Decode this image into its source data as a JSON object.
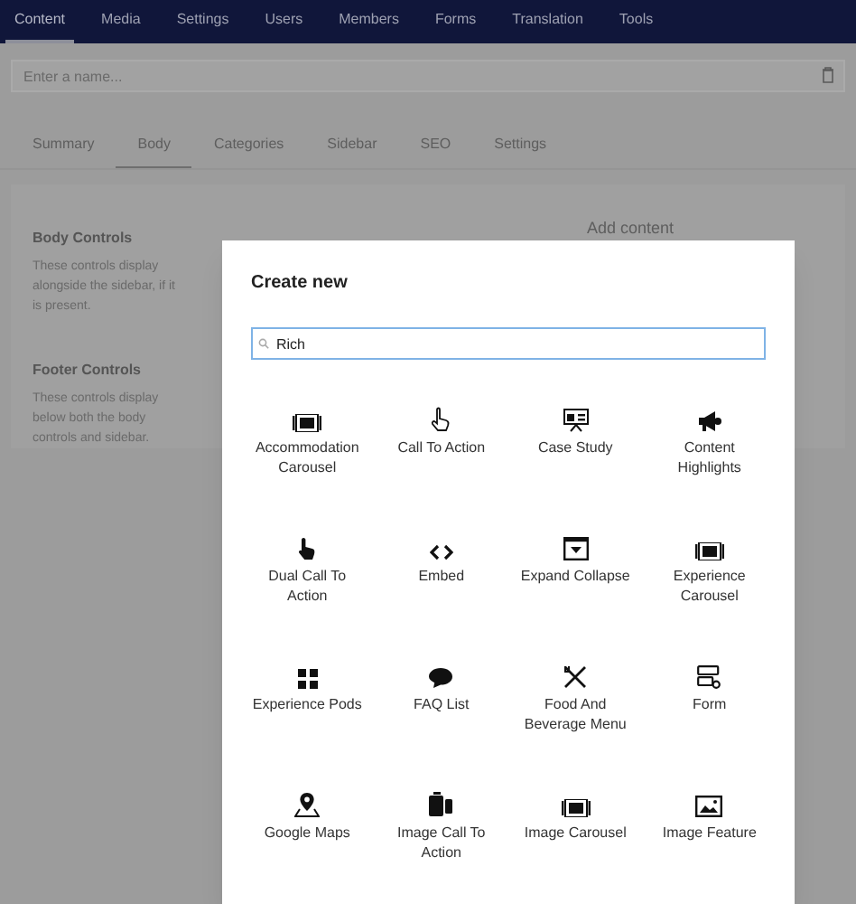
{
  "nav": [
    {
      "label": "Content",
      "selected": true
    },
    {
      "label": "Media",
      "selected": false
    },
    {
      "label": "Settings",
      "selected": false
    },
    {
      "label": "Users",
      "selected": false
    },
    {
      "label": "Members",
      "selected": false
    },
    {
      "label": "Forms",
      "selected": false
    },
    {
      "label": "Translation",
      "selected": false
    },
    {
      "label": "Tools",
      "selected": false
    }
  ],
  "name_field": {
    "placeholder": "Enter a name..."
  },
  "tabs": [
    {
      "label": "Summary",
      "selected": false
    },
    {
      "label": "Body",
      "selected": true
    },
    {
      "label": "Categories",
      "selected": false
    },
    {
      "label": "Sidebar",
      "selected": false
    },
    {
      "label": "SEO",
      "selected": false
    },
    {
      "label": "Settings",
      "selected": false
    }
  ],
  "sections": [
    {
      "title": "Body Controls",
      "description": "These controls display alongside the sidebar, if it is present."
    },
    {
      "title": "Footer Controls",
      "description": "These controls display below both the body controls and sidebar."
    }
  ],
  "add_content": "Add content",
  "dialog": {
    "title": "Create new",
    "search": {
      "value": "Rich"
    },
    "items": [
      {
        "label": "Accommodation Carousel",
        "kind": "carousel"
      },
      {
        "label": "Call To Action",
        "kind": "pointer"
      },
      {
        "label": "Case Study",
        "kind": "presentation"
      },
      {
        "label": "Content Highlights",
        "kind": "megaphone"
      },
      {
        "label": "Dual Call To Action",
        "kind": "hand"
      },
      {
        "label": "Embed",
        "kind": "code"
      },
      {
        "label": "Expand Collapse",
        "kind": "expand"
      },
      {
        "label": "Experience Carousel",
        "kind": "carousel"
      },
      {
        "label": "Experience Pods",
        "kind": "grid"
      },
      {
        "label": "FAQ List",
        "kind": "chat"
      },
      {
        "label": "Food And Beverage Menu",
        "kind": "cutlery"
      },
      {
        "label": "Form",
        "kind": "form"
      },
      {
        "label": "Google Maps",
        "kind": "map"
      },
      {
        "label": "Image Call To Action",
        "kind": "devices"
      },
      {
        "label": "Image Carousel",
        "kind": "carousel"
      },
      {
        "label": "Image Feature",
        "kind": "image"
      }
    ]
  }
}
